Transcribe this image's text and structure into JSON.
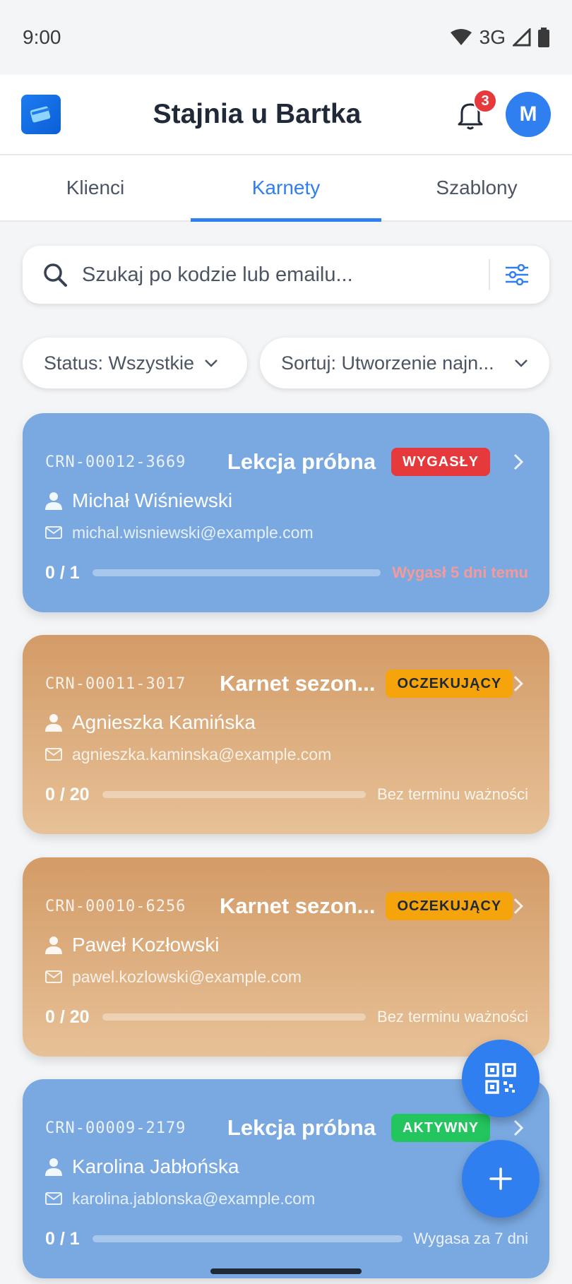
{
  "status_bar": {
    "time": "9:00",
    "network": "3G"
  },
  "app": {
    "title": "Stajnia u Bartka",
    "notifications": "3",
    "avatar_initial": "M"
  },
  "tabs": [
    {
      "label": "Klienci"
    },
    {
      "label": "Karnety",
      "active": true
    },
    {
      "label": "Szablony"
    }
  ],
  "search": {
    "placeholder": "Szukaj po kodzie lub emailu..."
  },
  "filters": {
    "status": "Status: Wszystkie",
    "sort": "Sortuj: Utworzenie najn..."
  },
  "cards": [
    {
      "code": "CRN-00012-3669",
      "title": "Lekcja próbna",
      "status": "WYGASŁY",
      "name": "Michał Wiśniewski",
      "email": "michal.wisniewski@example.com",
      "count": "0 / 1",
      "progress": 0,
      "expiry": "Wygasł 5 dni temu",
      "color": "#7aa9e2"
    },
    {
      "code": "CRN-00011-3017",
      "title": "Karnet sezon...",
      "status": "OCZEKUJĄCY",
      "name": "Agnieszka Kamińska",
      "email": "agnieszka.kaminska@example.com",
      "count": "0 / 20",
      "progress": 0,
      "expiry": "Bez terminu ważności",
      "color": "#d39b67"
    },
    {
      "code": "CRN-00010-6256",
      "title": "Karnet sezon...",
      "status": "OCZEKUJĄCY",
      "name": "Paweł Kozłowski",
      "email": "pawel.kozlowski@example.com",
      "count": "0 / 20",
      "progress": 0,
      "expiry": "Bez terminu ważności",
      "color": "#d39b67"
    },
    {
      "code": "CRN-00009-2179",
      "title": "Lekcja próbna",
      "status": "AKTYWNY",
      "name": "Karolina Jabłońska",
      "email": "karolina.jablonska@example.com",
      "count": "0 / 1",
      "progress": 0,
      "expiry": "Wygasa za 7 dni",
      "color": "#7aa9e2"
    }
  ],
  "colors": {
    "accent": "#2f7ff0",
    "expired": "#e5393b",
    "pending": "#f5a50b",
    "active": "#22c55e"
  }
}
